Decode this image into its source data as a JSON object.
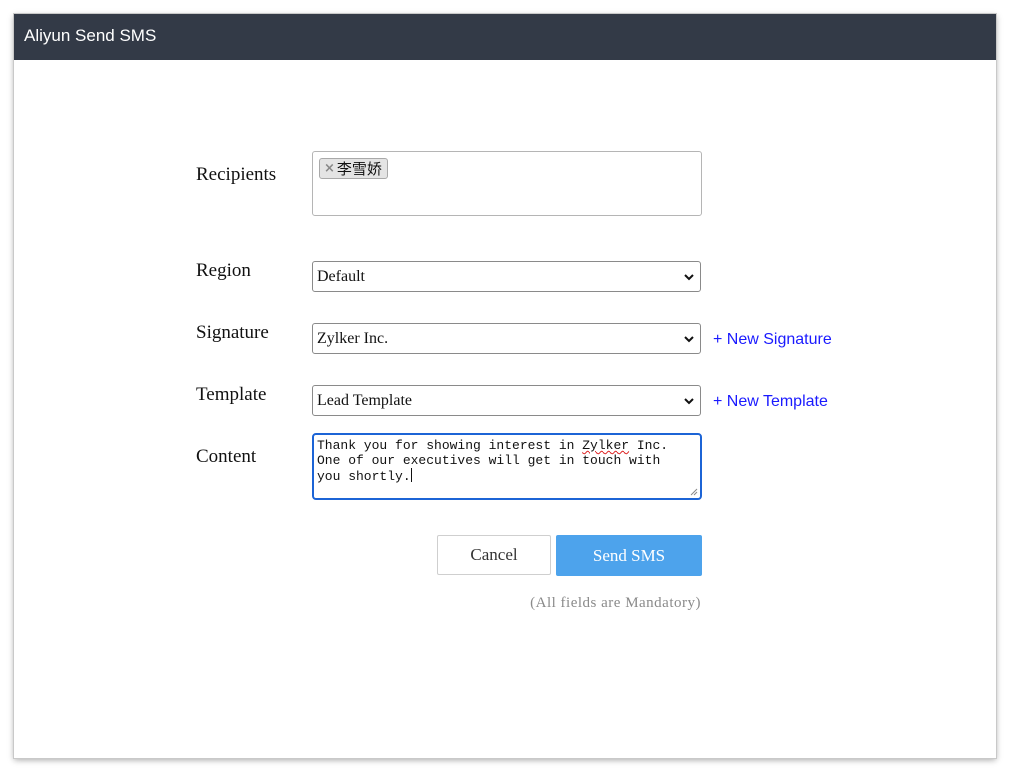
{
  "window": {
    "title": "Aliyun Send SMS"
  },
  "form": {
    "recipients": {
      "label": "Recipients",
      "chips": [
        {
          "remove_icon": "×",
          "name": "李雪娇"
        }
      ]
    },
    "region": {
      "label": "Region",
      "selected": "Default"
    },
    "signature": {
      "label": "Signature",
      "selected": "Zylker Inc.",
      "new_link": "+ New Signature"
    },
    "template": {
      "label": "Template",
      "selected": "Lead Template",
      "new_link": "+ New Template"
    },
    "content": {
      "label": "Content",
      "text_part1": "Thank you for showing interest in ",
      "text_misspelled": "Zylker",
      "text_part2": " Inc.\nOne of our executives will get in touch with\nyou shortly."
    }
  },
  "actions": {
    "cancel_label": "Cancel",
    "send_label": "Send SMS",
    "send_color": "#4da3ec",
    "mandatory_note": "(All fields are Mandatory)"
  },
  "colors": {
    "titlebar": "#333a47",
    "link": "#1a1aff",
    "focus": "#1c64d6"
  },
  "icons": {
    "chip_remove": "close-icon",
    "select_arrow": "chevron-down-icon",
    "resize": "resize-grip-icon"
  }
}
